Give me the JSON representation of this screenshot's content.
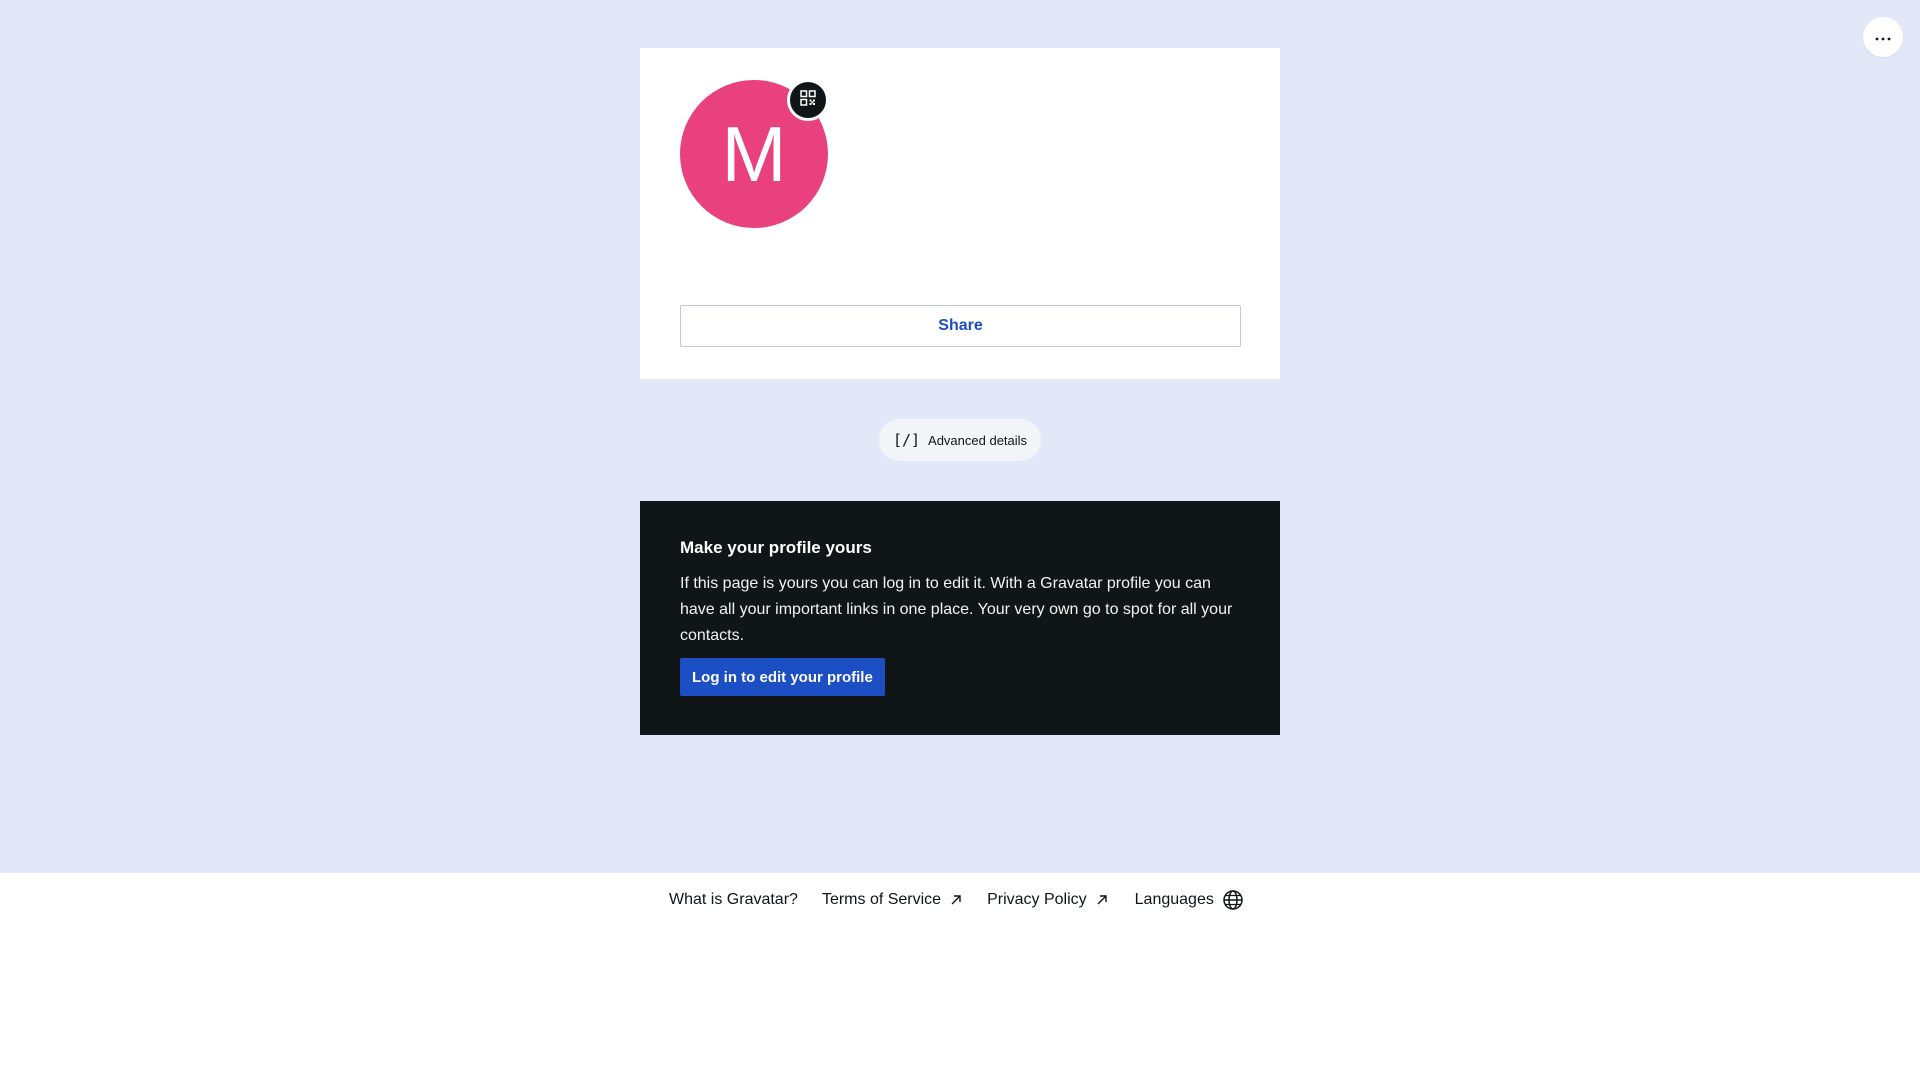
{
  "toolbar": {
    "more_icon": "ellipsis-horizontal-icon"
  },
  "profile": {
    "avatar_letter": "M",
    "avatar_color": "#e8417d",
    "qr_icon": "qr-code-icon",
    "share_label": "Share"
  },
  "advanced": {
    "icon_glyph": "[/]",
    "label": "Advanced details"
  },
  "cta": {
    "title": "Make your profile yours",
    "body": "If this page is yours you can log in to edit it. With a Gravatar profile you can have all your important links in one place. Your very own go to spot for all your contacts.",
    "button_label": "Log in to edit your profile",
    "button_color": "#1d4fc4",
    "background_color": "#101517"
  },
  "footer": {
    "links": [
      {
        "label": "What is Gravatar?"
      },
      {
        "label": "Terms of Service",
        "icon": "external-link-icon"
      },
      {
        "label": "Privacy Policy",
        "icon": "external-link-icon"
      },
      {
        "label": "Languages",
        "icon": "globe-icon"
      }
    ]
  },
  "colors": {
    "page_background": "#e3e8f9",
    "accent": "#1d4fc4"
  }
}
